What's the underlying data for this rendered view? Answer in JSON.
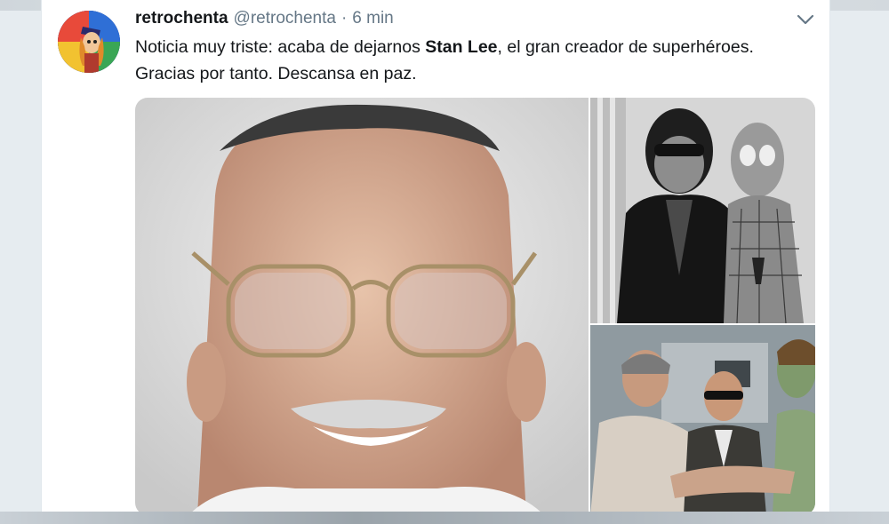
{
  "tweet": {
    "display_name": "retrochenta",
    "handle": "@retrochenta",
    "separator": "·",
    "timestamp": "6 min",
    "text_before": "Noticia muy triste: acaba de dejarnos ",
    "text_bold": "Stan Lee",
    "text_after": ", el gran creador de superhéroes.",
    "text_line2": "Gracias por tanto. Descansa en paz."
  },
  "icons": {
    "menu": "chevron-down-icon",
    "avatar": "avatar-illustration"
  },
  "media": {
    "photo_count": 3
  },
  "colors": {
    "name": "#14171a",
    "secondary": "#657786",
    "card_bg": "#ffffff",
    "page_bg": "#e6ecf0"
  }
}
